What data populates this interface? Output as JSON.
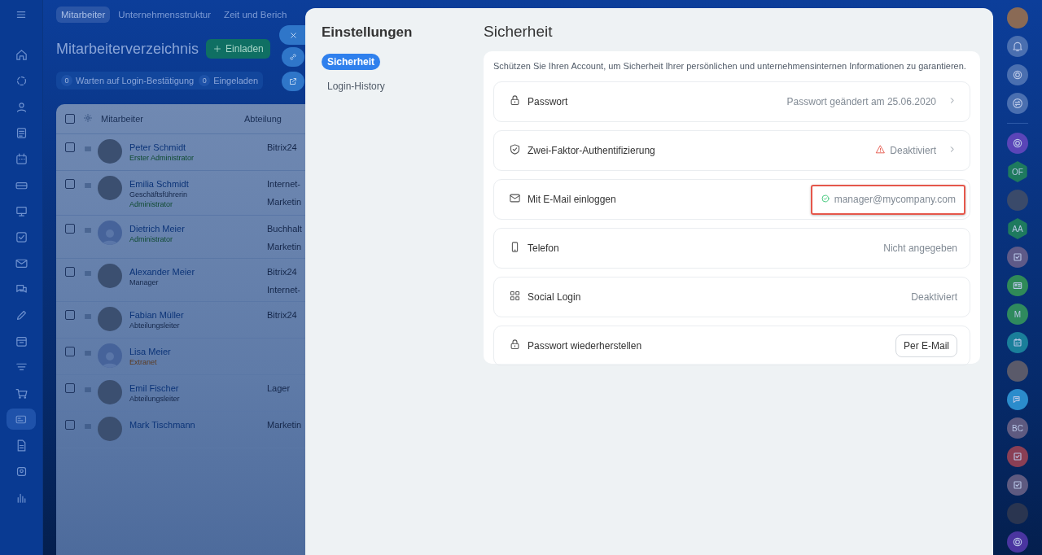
{
  "left_nav": {
    "items": [
      {
        "selected": false
      },
      {
        "selected": false
      },
      {
        "selected": false
      },
      {
        "selected": false
      },
      {
        "selected": false
      },
      {
        "selected": false
      },
      {
        "selected": false
      },
      {
        "selected": false
      },
      {
        "selected": false
      },
      {
        "selected": false
      },
      {
        "selected": false
      },
      {
        "selected": false
      },
      {
        "selected": false
      },
      {
        "selected": false
      },
      {
        "selected": true
      },
      {
        "selected": false
      },
      {
        "selected": false
      },
      {
        "selected": false
      }
    ]
  },
  "top_tabs": [
    {
      "label": "Mitarbeiter",
      "selected": true
    },
    {
      "label": "Unternehmensstruktur",
      "selected": false
    },
    {
      "label": "Zeit und Berich",
      "selected": false
    }
  ],
  "page_title": "Mitarbeiterverzeichnis",
  "invite_button": "Einladen",
  "counters": [
    {
      "count": "0",
      "label": "Warten auf Login-Bestätigung"
    },
    {
      "count": "0",
      "label": "Eingeladen"
    }
  ],
  "table": {
    "header_checkbox": {
      "checked": false
    },
    "columns": [
      "Mitarbeiter",
      "Abteilung"
    ],
    "rows": [
      {
        "checked": false,
        "name": "Peter Schmidt",
        "photo": true,
        "lines": [
          {
            "text": "Erster Administrator",
            "kind": "role"
          }
        ],
        "departments": [
          "Bitrix24"
        ]
      },
      {
        "checked": false,
        "name": "Emilia Schmidt",
        "photo": true,
        "lines": [
          {
            "text": "Geschäftsführerin",
            "kind": "position"
          },
          {
            "text": "Administrator",
            "kind": "role"
          }
        ],
        "departments": [
          "Internet-",
          "Marketin"
        ]
      },
      {
        "checked": false,
        "name": "Dietrich Meier",
        "photo": false,
        "lines": [
          {
            "text": "Administrator",
            "kind": "role"
          }
        ],
        "departments": [
          "Buchhalt",
          "Marketin"
        ]
      },
      {
        "checked": false,
        "name": "Alexander Meier",
        "photo": true,
        "lines": [
          {
            "text": "Manager",
            "kind": "position"
          }
        ],
        "departments": [
          "Bitrix24",
          "Internet-"
        ]
      },
      {
        "checked": false,
        "name": "Fabian Müller",
        "photo": true,
        "lines": [
          {
            "text": "Abteilungsleiter",
            "kind": "position"
          }
        ],
        "departments": [
          "Bitrix24"
        ]
      },
      {
        "checked": false,
        "name": "Lisa Meier",
        "photo": false,
        "lines": [
          {
            "text": "Extranet",
            "kind": "extranet"
          }
        ],
        "departments": []
      },
      {
        "checked": false,
        "name": "Emil Fischer",
        "photo": true,
        "lines": [
          {
            "text": "Abteilungsleiter",
            "kind": "position"
          }
        ],
        "departments": [
          "Lager"
        ]
      },
      {
        "checked": false,
        "name": "Mark Tischmann",
        "photo": true,
        "lines": [],
        "departments": [
          "Marketin"
        ]
      }
    ]
  },
  "settings": {
    "title": "Einstellungen",
    "menu": [
      {
        "label": "Sicherheit",
        "selected": true
      },
      {
        "label": "Login-History",
        "selected": false
      }
    ],
    "heading": "Sicherheit",
    "description": "Schützen Sie Ihren Account, um Sicherheit Ihrer persönlichen und unternehmensinternen Informationen zu garantieren.",
    "rows": [
      {
        "label": "Passwort",
        "kind": "link",
        "value": "Passwort geändert am 25.06.2020",
        "warning": false,
        "highlighted": false
      },
      {
        "label": "Zwei-Faktor-Authentifizierung",
        "kind": "link",
        "value": "Deaktiviert",
        "warning": true,
        "highlighted": false
      },
      {
        "label": "Mit E-Mail einloggen",
        "kind": "verified",
        "value": "manager@mycompany.com",
        "warning": false,
        "highlighted": true
      },
      {
        "label": "Telefon",
        "kind": "text",
        "value": "Nicht angegeben",
        "warning": false,
        "highlighted": false
      },
      {
        "label": "Social Login",
        "kind": "text",
        "value": "Deaktiviert",
        "warning": false,
        "highlighted": false
      },
      {
        "label": "Passwort wiederherstellen",
        "kind": "button",
        "value": "Per E-Mail",
        "warning": false,
        "highlighted": false
      }
    ]
  },
  "right_rail": {
    "items": [
      {
        "kind": "photo",
        "color": "#8a6a55"
      },
      {
        "kind": "glyph",
        "color": "#4a6fb0"
      },
      {
        "kind": "glyph",
        "color": "#4a6fb0"
      },
      {
        "kind": "glyph",
        "color": "#4a6fb0"
      },
      {
        "kind": "glyph",
        "color": "#5a45b8"
      },
      {
        "kind": "hexagon",
        "initials": "OF",
        "color": "#1e7a5e"
      },
      {
        "kind": "photo",
        "color": "#3a4a6a"
      },
      {
        "kind": "hexagon",
        "initials": "AA",
        "color": "#1e7a5e"
      },
      {
        "kind": "glyph",
        "color": "#5e5a88"
      },
      {
        "kind": "glyph",
        "color": "#2f8a58"
      },
      {
        "kind": "initials",
        "initials": "M",
        "color": "#2f8a5e"
      },
      {
        "kind": "glyph",
        "color": "#1a7f9a"
      },
      {
        "kind": "photo",
        "color": "#5a5a6a"
      },
      {
        "kind": "glyph",
        "color": "#2b8ccc"
      },
      {
        "kind": "initials",
        "initials": "BC",
        "color": "#5e5a80"
      },
      {
        "kind": "glyph",
        "color": "#8a3f55"
      },
      {
        "kind": "glyph",
        "color": "#5e5a80"
      },
      {
        "kind": "photo",
        "color": "#2a3550"
      },
      {
        "kind": "glyph",
        "color": "#4a35a0"
      }
    ]
  }
}
